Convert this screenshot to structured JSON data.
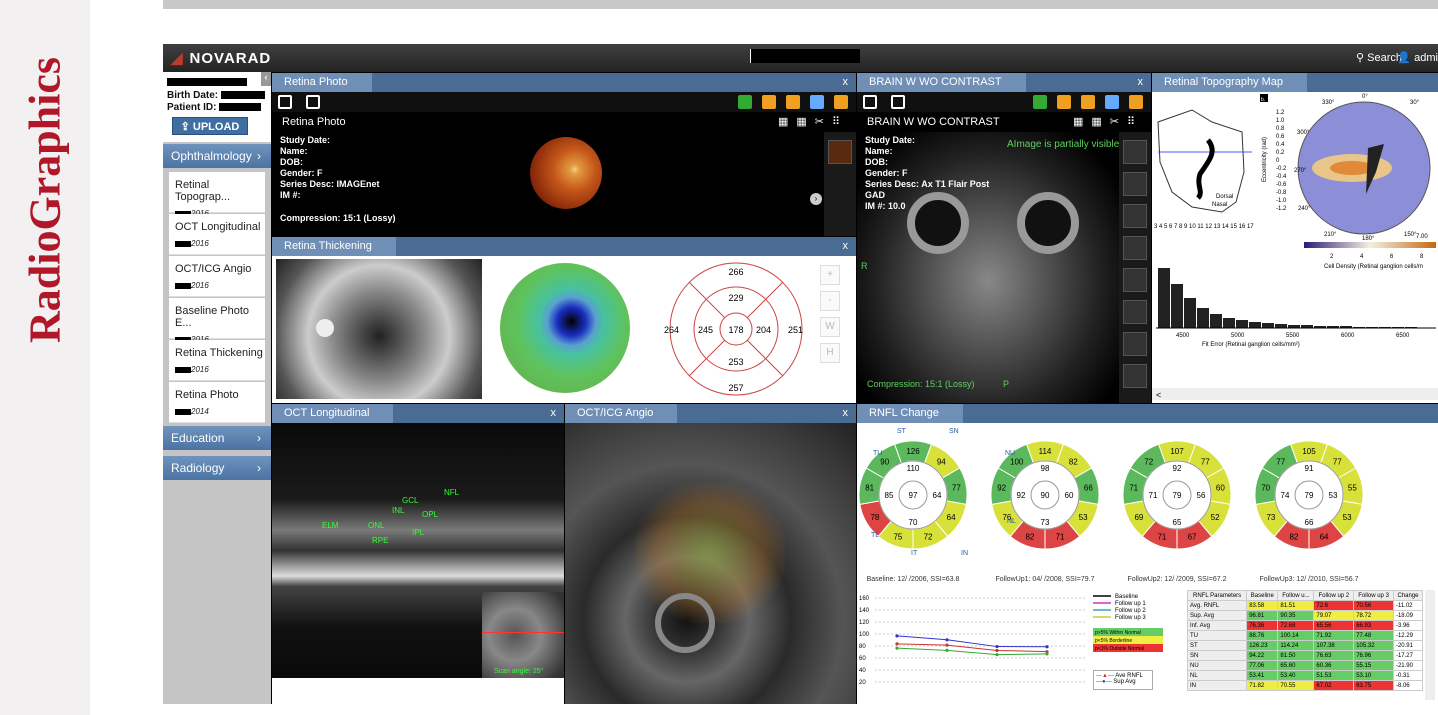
{
  "journal": "RadioGraphics",
  "app": {
    "logo": "NOVARAD",
    "search": "Search",
    "user": "admi"
  },
  "patient": {
    "birth_label": "Birth Date:",
    "id_label": "Patient ID:",
    "upload": "UPLOAD"
  },
  "sidebar": {
    "section": "Ophthalmology",
    "items": [
      {
        "label": "Retinal Topograp...",
        "date": "2016"
      },
      {
        "label": "OCT Longitudinal",
        "date": "2016"
      },
      {
        "label": "OCT/ICG Angio",
        "date": "2016"
      },
      {
        "label": "Baseline Photo E...",
        "date": "2016"
      },
      {
        "label": "Retina Thickening",
        "date": "2016"
      },
      {
        "label": "Retina Photo",
        "date": "2014"
      }
    ],
    "education": "Education",
    "radiology": "Radiology"
  },
  "close": "x",
  "retina_photo": {
    "tab": "Retina Photo",
    "viewport": "Retina Photo",
    "study_date": "Study Date:",
    "name": "Name:",
    "dob": "DOB:",
    "gender": "Gender: F",
    "series": "Series Desc: IMAGEnet",
    "im": "IM #:",
    "compression": "Compression: 15:1 (Lossy)"
  },
  "brain": {
    "tab": "BRAIN W WO CONTRAST",
    "viewport": "BRAIN W WO CONTRAST",
    "study_date": "Study Date:",
    "name": "Name:",
    "dob": "DOB:",
    "gender": "Gender: F",
    "series": "Series Desc: Ax T1 Flair Post",
    "gad": "GAD",
    "im": "IM #: 10.0",
    "partial": "Image is partially visible",
    "compression": "Compression: 15:1 (Lossy)",
    "a": "A",
    "p": "P",
    "r": "R"
  },
  "topo": {
    "tab": "Retinal Topography Map",
    "b": "b.",
    "nasal": "Nasal",
    "dorsal": "Dorsal",
    "ecc": "Eccentricity (rad)",
    "bottom_ticks": "3 4 5 6 7 8 9 10 11 12 13 14 15 16 17",
    "yticks": [
      "1.2",
      "1.0",
      "0.8",
      "0.6",
      "0.4",
      "0.2",
      "0",
      "-0.2",
      "-0.4",
      "-0.6",
      "-0.8",
      "-1.0",
      "-1.2"
    ],
    "angles": [
      "330°",
      "0°",
      "30°",
      "300°",
      "270°",
      "240°",
      "210°",
      "180°",
      "150°"
    ],
    "cb_ticks": [
      "2",
      "4",
      "6",
      "8"
    ],
    "cb_top": "7.00",
    "cb_label": "Cell Density (Retinal ganglion cells/m",
    "hist_x": [
      "4500",
      "5000",
      "5500",
      "6000",
      "6500"
    ],
    "hist_label": "Fit Error (Retinal ganglion cells/mm²)",
    "lt": "<"
  },
  "thick": {
    "tab": "Retina Thickening",
    "values": {
      "top": "266",
      "upper": "229",
      "left_out": "264",
      "left_in": "245",
      "center": "178",
      "right_in": "204",
      "right_out": "251",
      "lower": "253",
      "bottom": "257"
    },
    "btns": [
      "+",
      "-",
      "W",
      "H"
    ]
  },
  "oct": {
    "tab": "OCT Longitudinal",
    "labels": [
      "ELM",
      "ONL",
      "INL",
      "OPL",
      "NFL",
      "GCL",
      "IPL",
      "RPE"
    ],
    "scan": "Scan angle: 25°"
  },
  "icg": {
    "tab": "OCT/ICG Angio"
  },
  "rnfl": {
    "tab": "RNFL Change",
    "sectors": [
      "ST",
      "SN",
      "TU",
      "NU",
      "TL",
      "NL",
      "IT",
      "IN"
    ],
    "charts": [
      {
        "caption": "Baseline: 12/    /2006, SSI=63.8",
        "outer": [
          "126",
          "94",
          "77",
          "64",
          "72",
          "75",
          "78",
          "81",
          "90"
        ],
        "inner": [
          "110",
          "64",
          "70",
          "85"
        ],
        "center": "97"
      },
      {
        "caption": "FollowUp1: 04/    /2008, SSI=79.7",
        "outer": [
          "114",
          "82",
          "66",
          "53",
          "71",
          "82",
          "76",
          "92",
          "100"
        ],
        "inner": [
          "98",
          "60",
          "73",
          "92"
        ],
        "center": "90"
      },
      {
        "caption": "FollowUp2: 12/    /2009, SSI=67.2",
        "outer": [
          "107",
          "77",
          "60",
          "52",
          "67",
          "71",
          "69",
          "71",
          "72"
        ],
        "inner": [
          "92",
          "56",
          "65",
          "71"
        ],
        "center": "79"
      },
      {
        "caption": "FollowUp3: 12/    /2010, SSI=56.7",
        "outer": [
          "105",
          "77",
          "55",
          "53",
          "64",
          "82",
          "73",
          "70",
          "77"
        ],
        "inner": [
          "91",
          "53",
          "66",
          "74"
        ],
        "center": "79"
      }
    ],
    "y_ticks": [
      "160",
      "140",
      "120",
      "100",
      "80",
      "60",
      "40",
      "20"
    ],
    "legend": [
      "Baseline",
      "Follow up 1",
      "Follow up 2",
      "Follow up 3"
    ],
    "norm": [
      "p>5% Within Normal",
      "p<5% Borderline",
      "p<1% Outside Normal"
    ],
    "lines_legend": [
      "Ave RNFL",
      "Sup Avg"
    ],
    "table_head": [
      "RNFL Parameters",
      "Baseline",
      "Follow u...",
      "Follow up 2",
      "Follow up 3",
      "Change"
    ],
    "table_rows": [
      [
        "Avg. RNFL",
        "83.58",
        "81.51",
        "72.6",
        "70.56",
        "-11.02"
      ],
      [
        "Sup. Avg",
        "96.81",
        "90.35",
        "79.07",
        "78.72",
        "-18.09"
      ],
      [
        "Inf. Avg",
        "76.36",
        "72.68",
        "65.56",
        "66.93",
        "-3.96"
      ],
      [
        "TU",
        "88.76",
        "100.14",
        "71.92",
        "77.48",
        "-12.29"
      ],
      [
        "ST",
        "126.23",
        "114.24",
        "107.38",
        "105.32",
        "-20.91"
      ],
      [
        "SN",
        "94.22",
        "81.50",
        "76.63",
        "76.96",
        "-17.27"
      ],
      [
        "NU",
        "77.06",
        "65.60",
        "60.36",
        "55.15",
        "-21.90"
      ],
      [
        "NL",
        "53.41",
        "53.40",
        "51.53",
        "53.10",
        "-0.31"
      ],
      [
        "IN",
        "71.82",
        "70.55",
        "67.02",
        "63.75",
        "-8.06"
      ]
    ]
  }
}
